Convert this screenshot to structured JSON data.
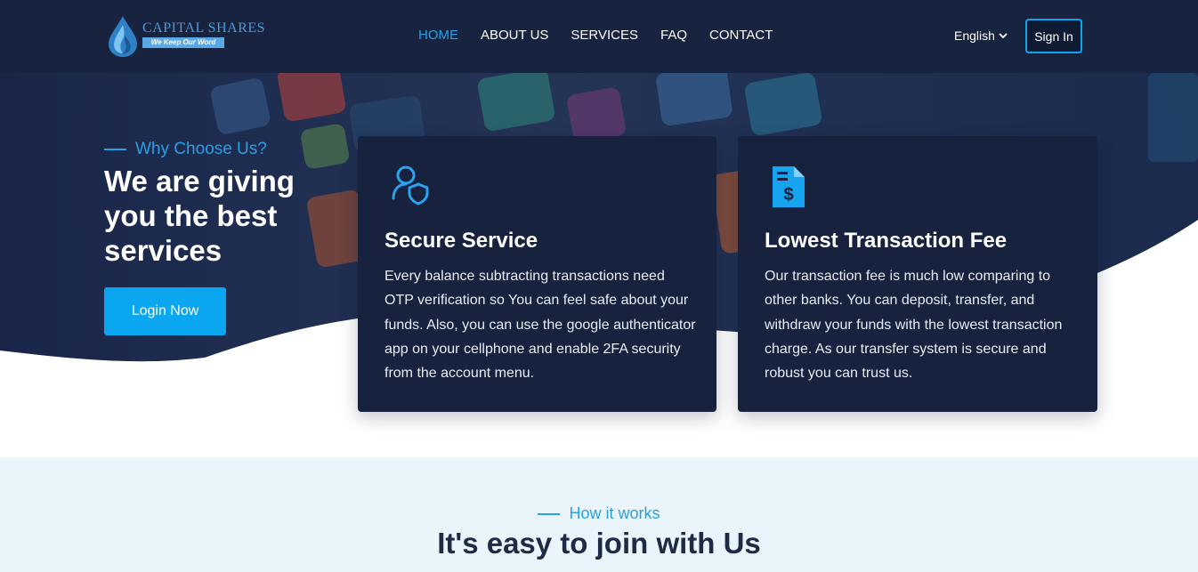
{
  "brand": {
    "name": "Capital Shares",
    "name_display": "CAPITAL SHARES",
    "tagline": "We Keep Our Word"
  },
  "nav": {
    "items": [
      {
        "label": "HOME",
        "active": true
      },
      {
        "label": "ABOUT US",
        "active": false
      },
      {
        "label": "SERVICES",
        "active": false
      },
      {
        "label": "FAQ",
        "active": false
      },
      {
        "label": "CONTACT",
        "active": false
      }
    ]
  },
  "header": {
    "language": "English",
    "signin_label": "Sign In"
  },
  "hero": {
    "eyebrow": "Why Choose Us?",
    "title": "We are giving you the best services",
    "login_label": "Login Now"
  },
  "features": [
    {
      "icon": "user-shield-icon",
      "title": "Secure Service",
      "text": "Every balance subtracting transactions need OTP verification so You can feel safe about your funds. Also, you can use the google authenticator app on your cellphone and enable 2FA security from the account menu."
    },
    {
      "icon": "invoice-dollar-icon",
      "title": "Lowest Transaction Fee",
      "text": "Our transaction fee is much low comparing to other banks. You can deposit, transfer, and withdraw your funds with the lowest transaction charge. As our transfer system is secure and robust you can trust us."
    }
  ],
  "how_it_works": {
    "eyebrow": "How it works",
    "title": "It's easy to join with Us"
  },
  "colors": {
    "navy": "#18233f",
    "accent": "#0ba6f0",
    "light_bg": "#eaf5fb"
  }
}
